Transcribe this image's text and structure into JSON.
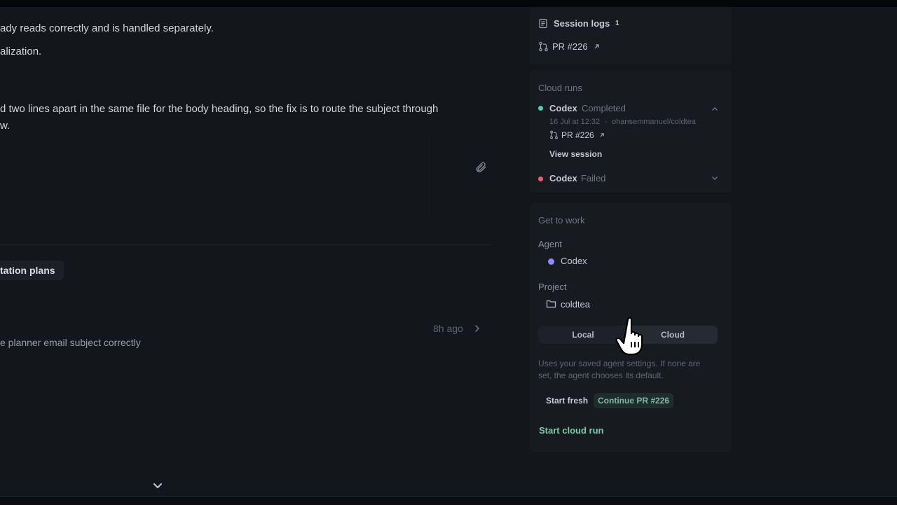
{
  "chat": {
    "line1": "ady reads correctly and is handled separately.",
    "line2": "alization.",
    "line3": "d two lines apart in the same file for the body heading, so the fix is to route the subject through",
    "line4": "w.",
    "task_title": "tation plans",
    "task_subtitle": "e planner email subject correctly",
    "task_time": "8h ago"
  },
  "panel": {
    "session_logs": {
      "label": "Session logs",
      "count": "1"
    },
    "pr_link": "PR #226",
    "cloud_runs": {
      "title": "Cloud runs",
      "runs": [
        {
          "agent": "Codex",
          "status": "Completed",
          "date": "16 Jul at 12:32",
          "repo": "ohansemmanuel/coldtea",
          "pr": "PR #226",
          "view": "View session",
          "status_color": "#4fd1b1"
        },
        {
          "agent": "Codex",
          "status": "Failed",
          "status_color": "#e0607a"
        }
      ]
    },
    "get_to_work": {
      "title": "Get to work",
      "agent_label": "Agent",
      "agent_value": "Codex",
      "agent_color": "#8c8cff",
      "project_label": "Project",
      "project_value": "coldtea",
      "mode_local": "Local",
      "mode_cloud": "Cloud",
      "selected_mode": "Cloud",
      "help_line1": "Uses your saved agent settings. If none are",
      "help_line2": "set, the agent chooses its default.",
      "start_fresh": "Start fresh",
      "continue_pr": "Continue PR #226",
      "start_cloud_run": "Start cloud run"
    }
  }
}
